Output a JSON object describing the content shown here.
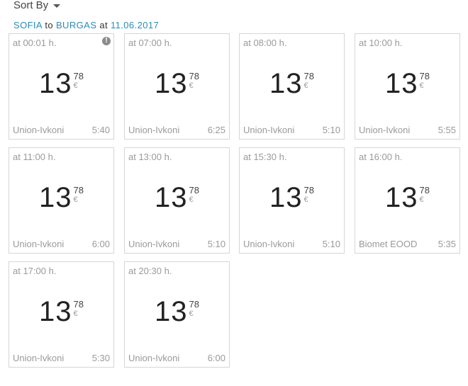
{
  "sort": {
    "label": "Sort By",
    "icon": "caret-down-icon"
  },
  "route": {
    "from": "SOFIA",
    "to_word": "to",
    "to": "BURGAS",
    "at_word": "at",
    "date": "11.06.2017"
  },
  "currency": "€",
  "departures": [
    {
      "time": "at 00:01 h.",
      "price_int": "13",
      "price_dec": "78",
      "carrier": "Union-Ivkoni",
      "duration": "5:40",
      "info": true
    },
    {
      "time": "at 07:00 h.",
      "price_int": "13",
      "price_dec": "78",
      "carrier": "Union-Ivkoni",
      "duration": "6:25",
      "info": false
    },
    {
      "time": "at 08:00 h.",
      "price_int": "13",
      "price_dec": "78",
      "carrier": "Union-Ivkoni",
      "duration": "5:10",
      "info": false
    },
    {
      "time": "at 10:00 h.",
      "price_int": "13",
      "price_dec": "78",
      "carrier": "Union-Ivkoni",
      "duration": "5:55",
      "info": false
    },
    {
      "time": "at 11:00 h.",
      "price_int": "13",
      "price_dec": "78",
      "carrier": "Union-Ivkoni",
      "duration": "6:00",
      "info": false
    },
    {
      "time": "at 13:00 h.",
      "price_int": "13",
      "price_dec": "78",
      "carrier": "Union-Ivkoni",
      "duration": "5:10",
      "info": false
    },
    {
      "time": "at 15:30 h.",
      "price_int": "13",
      "price_dec": "78",
      "carrier": "Union-Ivkoni",
      "duration": "5:10",
      "info": false
    },
    {
      "time": "at 16:00 h.",
      "price_int": "13",
      "price_dec": "78",
      "carrier": "Biomet EOOD",
      "duration": "5:35",
      "info": false
    },
    {
      "time": "at 17:00 h.",
      "price_int": "13",
      "price_dec": "78",
      "carrier": "Union-Ivkoni",
      "duration": "5:30",
      "info": false
    },
    {
      "time": "at 20:30 h.",
      "price_int": "13",
      "price_dec": "78",
      "carrier": "Union-Ivkoni",
      "duration": "6:00",
      "info": false
    }
  ],
  "colors": {
    "link": "#2a8cb7",
    "card_border": "#d6d6d6",
    "muted_text": "#9a9a9a"
  }
}
